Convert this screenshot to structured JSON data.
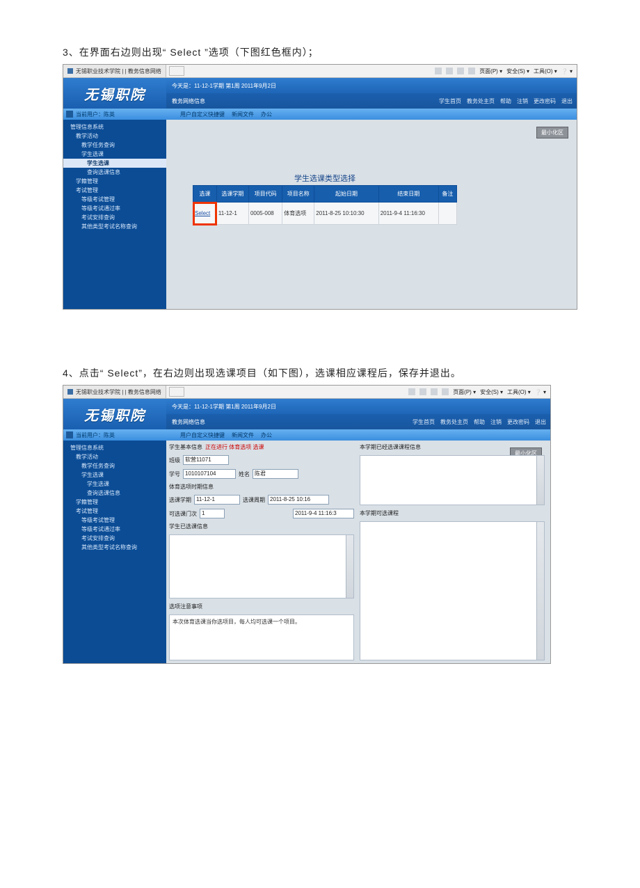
{
  "doc": {
    "step3": "3、在界面右边则出现“ Select ”选项（下图红色框内）；",
    "step4": "4、点击“ Select”，在右边则出现选课项目（如下图），选课相应课程后，保存并退出。"
  },
  "ie": {
    "tab_title": "无锡职业技术学院 | | 教务信息网络",
    "menu": {
      "page": "页面(P) ▾",
      "safety": "安全(S) ▾",
      "tools": "工具(O) ▾",
      "help": "❔ ▾"
    }
  },
  "app": {
    "brand": "无锡职院",
    "date_line": "今天是：11-12-1学期 第1周 2011年9月2日",
    "subtitle": "教务网络信息",
    "topnav": [
      "学生首页",
      "教务处主页",
      "帮助",
      "注销",
      "更改密码",
      "退出"
    ],
    "userbar": {
      "prefix": "当前用户：陈英",
      "links": [
        "用户自定义快捷键",
        "新闻文件",
        "办公"
      ]
    },
    "button_min": "最小化区"
  },
  "sidebar": {
    "items": [
      {
        "label": "管理信息系统",
        "level": 1
      },
      {
        "label": "教学活动",
        "level": 2
      },
      {
        "label": "教学任务查询",
        "level": 3
      },
      {
        "label": "学生选课",
        "level": 3
      },
      {
        "label": "学生选课",
        "level": 4,
        "selected": true
      },
      {
        "label": "查询选课信息",
        "level": 4
      },
      {
        "label": "学籍管理",
        "level": 2
      },
      {
        "label": "考试管理",
        "level": 2
      },
      {
        "label": "等级考试管理",
        "level": 3
      },
      {
        "label": "等级考试通过率",
        "level": 3
      },
      {
        "label": "考试安排查询",
        "level": 3
      },
      {
        "label": "其他类型考试名称查询",
        "level": 3
      }
    ]
  },
  "table": {
    "title": "学生选课类型选择",
    "headers": [
      "选课",
      "选课学期",
      "项目代码",
      "项目名称",
      "起始日期",
      "结束日期",
      "备注"
    ],
    "row": {
      "select": "Select",
      "term": "11-12-1",
      "code": "0005-008",
      "name": "体育选项",
      "start": "2011-8-25 10:10:30",
      "end": "2011-9-4 11:16:30",
      "remark": ""
    }
  },
  "form": {
    "top_label": "学生基本信息",
    "top_status": "正在进行 体育选项 选课",
    "class_lbl": "班级",
    "class_val": "软营11071",
    "sno_lbl": "学号",
    "sno_val": "1010107104",
    "name_lbl": "姓名",
    "name_val": "陈君",
    "section_period": "体育选项时期信息",
    "term_lbl": "选课学期",
    "term_val": "11-12-1",
    "perm_lbl": "选课周期",
    "perm_val": "2011-8-25 10:16",
    "count_lbl": "可选课门次",
    "count_val": "1",
    "end_val": "2011-9-4 11:16:3",
    "left_sel_label": "学生已选课信息",
    "notes_label": "选项注意事项",
    "notes_text": "本次体育选课当你选项目，每人均可选课一个项目。",
    "right_top_label": "本学期已经选课课程信息",
    "right_bottom_label": "本学期可选课程"
  }
}
